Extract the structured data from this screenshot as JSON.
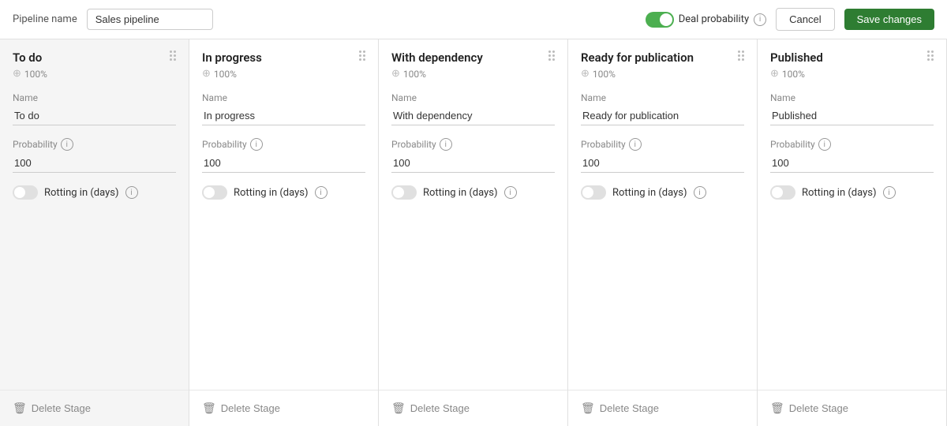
{
  "header": {
    "pipeline_name_label": "Pipeline name",
    "pipeline_name_value": "Sales pipeline",
    "deal_probability_label": "Deal probability",
    "cancel_label": "Cancel",
    "save_label": "Save changes"
  },
  "stages": [
    {
      "id": "to-do",
      "title": "To do",
      "percent": "100%",
      "name_label": "Name",
      "name_value": "To do",
      "probability_label": "Probability",
      "probability_value": "100",
      "rotting_label": "Rotting in (days)",
      "rotting_active": false,
      "delete_label": "Delete Stage",
      "is_first": true
    },
    {
      "id": "in-progress",
      "title": "In progress",
      "percent": "100%",
      "name_label": "Name",
      "name_value": "In progress",
      "probability_label": "Probability",
      "probability_value": "100",
      "rotting_label": "Rotting in (days)",
      "rotting_active": false,
      "delete_label": "Delete Stage",
      "is_first": false
    },
    {
      "id": "with-dependency",
      "title": "With dependency",
      "percent": "100%",
      "name_label": "Name",
      "name_value": "With dependency",
      "probability_label": "Probability",
      "probability_value": "100",
      "rotting_label": "Rotting in (days)",
      "rotting_active": false,
      "delete_label": "Delete Stage",
      "is_first": false
    },
    {
      "id": "ready-for-publication",
      "title": "Ready for publication",
      "percent": "100%",
      "name_label": "Name",
      "name_value": "Ready for publication",
      "probability_label": "Probability",
      "probability_value": "100",
      "rotting_label": "Rotting in (days)",
      "rotting_active": false,
      "delete_label": "Delete Stage",
      "is_first": false
    },
    {
      "id": "published",
      "title": "Published",
      "percent": "100%",
      "name_label": "Name",
      "name_value": "Published",
      "probability_label": "Probability",
      "probability_value": "100",
      "rotting_label": "Rotting in (days)",
      "rotting_active": false,
      "delete_label": "Delete Stage",
      "is_first": false
    }
  ]
}
